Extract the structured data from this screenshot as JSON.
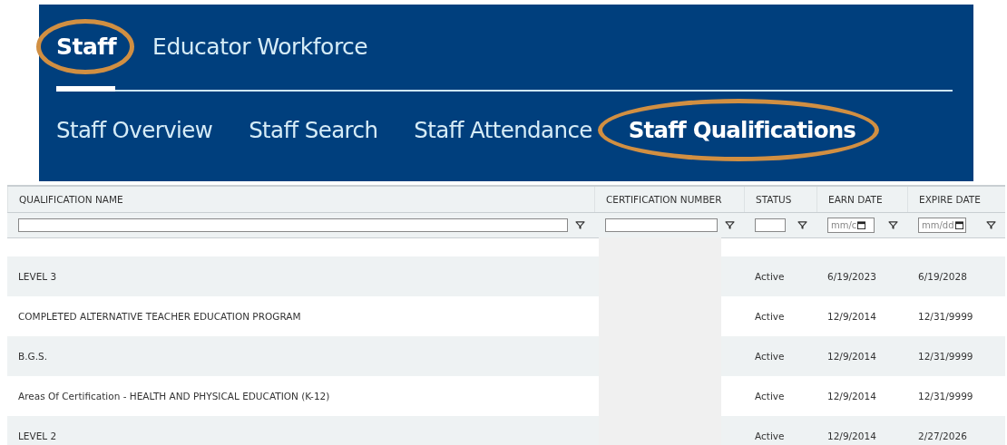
{
  "primary_tabs": [
    {
      "label": "Staff",
      "selected": true,
      "highlighted": true
    },
    {
      "label": "Educator Workforce",
      "selected": false,
      "highlighted": false
    }
  ],
  "secondary_tabs": [
    {
      "label": "Staff Overview",
      "selected": false,
      "highlighted": false
    },
    {
      "label": "Staff Search",
      "selected": false,
      "highlighted": false
    },
    {
      "label": "Staff Attendance",
      "selected": false,
      "highlighted": false
    },
    {
      "label": "Staff Qualifications",
      "selected": true,
      "highlighted": true
    }
  ],
  "table": {
    "columns": [
      {
        "label": "QUALIFICATION NAME",
        "kind": "text"
      },
      {
        "label": "CERTIFICATION NUMBER",
        "kind": "text"
      },
      {
        "label": "STATUS",
        "kind": "text"
      },
      {
        "label": "EARN DATE",
        "kind": "date",
        "placeholder": "mm/c"
      },
      {
        "label": "EXPIRE DATE",
        "kind": "date",
        "placeholder": "mm/dd"
      }
    ],
    "rows": [
      {
        "cells": [
          "LEVEL 3",
          "",
          "Active",
          "6/19/2023",
          "6/19/2028"
        ]
      },
      {
        "cells": [
          "COMPLETED ALTERNATIVE TEACHER EDUCATION PROGRAM",
          "",
          "Active",
          "12/9/2014",
          "12/31/9999"
        ]
      },
      {
        "cells": [
          "B.G.S.",
          "",
          "Active",
          "12/9/2014",
          "12/31/9999"
        ]
      },
      {
        "cells": [
          "Areas Of Certification - HEALTH AND PHYSICAL EDUCATION (K-12)",
          "",
          "Active",
          "12/9/2014",
          "12/31/9999"
        ]
      },
      {
        "cells": [
          "LEVEL 2",
          "",
          "Active",
          "12/9/2014",
          "2/27/2026"
        ]
      }
    ]
  }
}
